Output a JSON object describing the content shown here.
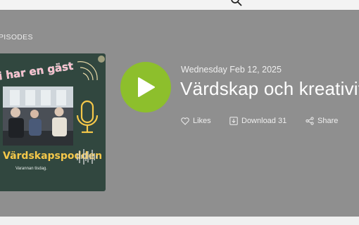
{
  "section": {
    "label": "PISODES"
  },
  "episode": {
    "date": "Wednesday Feb 12, 2025",
    "title": "Värdskap och kreativit"
  },
  "actions": {
    "likes_label": "Likes",
    "download_label": "Download 31",
    "share_label": "Share"
  },
  "cover": {
    "headline": "i har en gäst",
    "show_name": "Värdskapspodden",
    "tagline": "Varannan tisdag."
  },
  "colors": {
    "play_button": "#8dbf2c",
    "background": "#8f8f8f",
    "cover_background": "#31473f",
    "cover_headline": "#f7b8c8",
    "cover_show_name": "#f5c84a"
  },
  "icons": {
    "play": "play-icon",
    "like": "heart-icon",
    "download": "download-icon",
    "share": "share-icon",
    "search": "search-icon",
    "microphone": "microphone-icon"
  }
}
